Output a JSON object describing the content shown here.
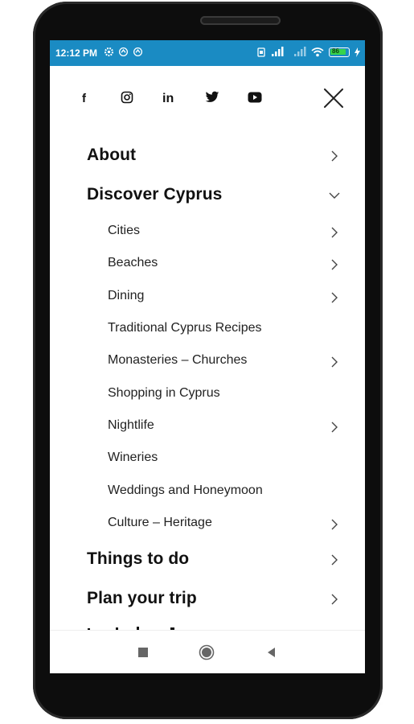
{
  "status_bar": {
    "time": "12:12 PM",
    "battery": "86",
    "background_color": "#1a8bc3"
  },
  "social_icons": [
    {
      "name": "facebook-icon",
      "glyph": "f"
    },
    {
      "name": "instagram-icon",
      "glyph": "instagram"
    },
    {
      "name": "linkedin-icon",
      "glyph": "in"
    },
    {
      "name": "twitter-icon",
      "glyph": "twitter"
    },
    {
      "name": "youtube-icon",
      "glyph": "youtube"
    }
  ],
  "close_icon": "close-icon",
  "menu": {
    "about": "About",
    "discover_cyprus": "Discover Cyprus",
    "cities": "Cities",
    "beaches": "Beaches",
    "dining": "Dining",
    "traditional_recipes": "Traditional Cyprus Recipes",
    "monasteries": "Monasteries – Churches",
    "shopping": "Shopping in Cyprus",
    "nightlife": "Nightlife",
    "wineries": "Wineries",
    "weddings": "Weddings and Honeymoon",
    "culture": "Culture – Heritage",
    "things_to_do": "Things to do",
    "plan_trip": "Plan your trip"
  },
  "nav_bar": {
    "recent": "square-icon",
    "home": "circle-icon",
    "back": "back-triangle-icon"
  }
}
